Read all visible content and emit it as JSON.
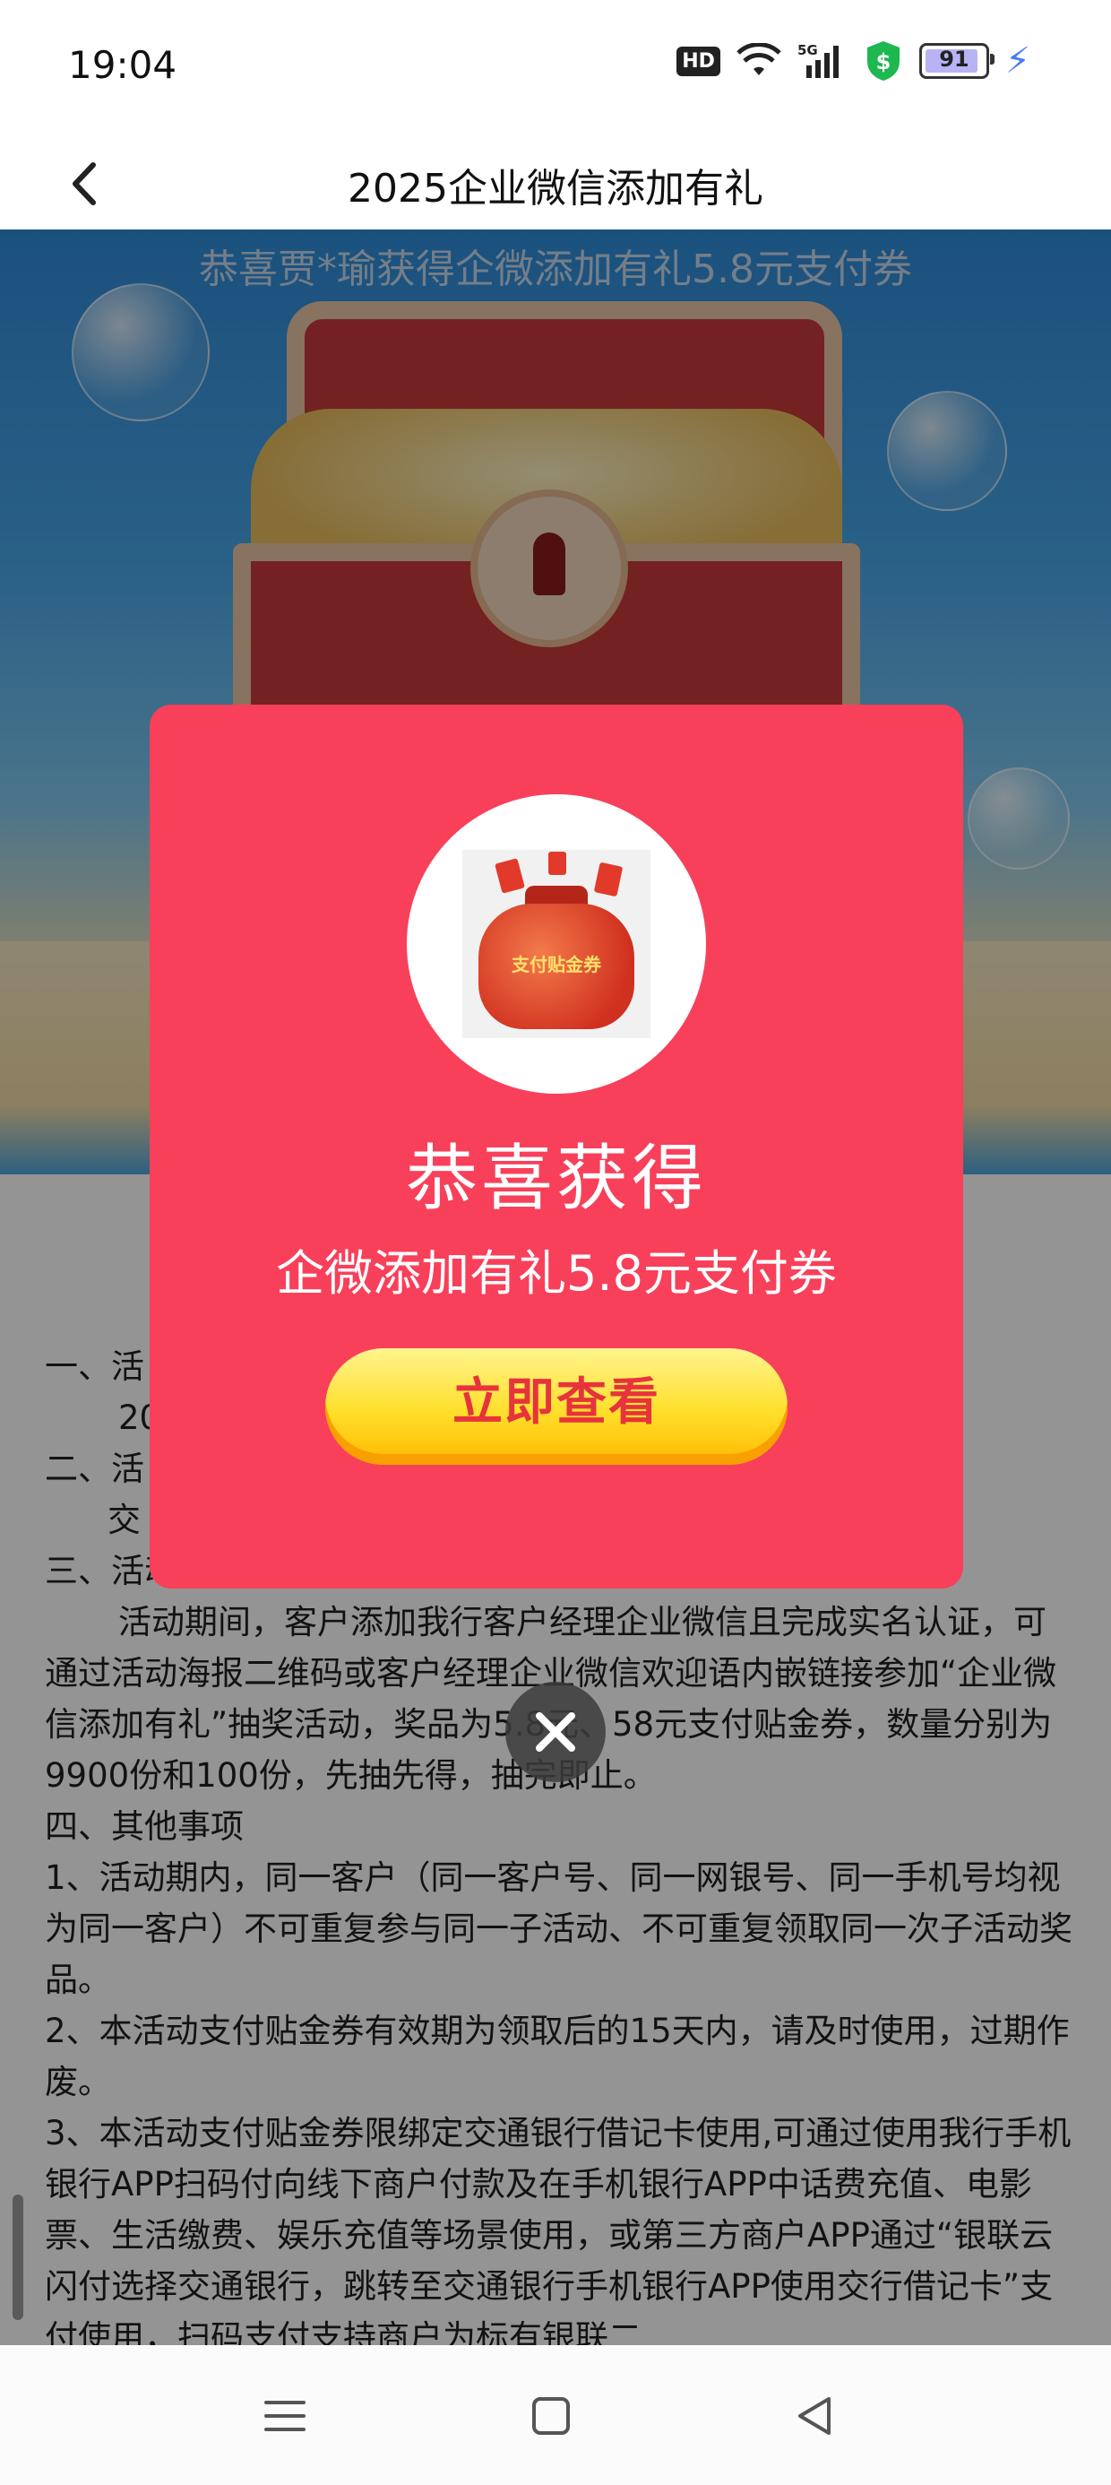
{
  "status_bar": {
    "time": "19:04",
    "hd_label": "HD",
    "network": "5G",
    "battery": "91",
    "battery_level": 0.91
  },
  "nav": {
    "title": "2025企业微信添加有礼"
  },
  "banner": {
    "message": "恭喜贾*瑜获得企微添加有礼5.8元支付券"
  },
  "rules": {
    "section1_prefix": "一、活",
    "section1_line2": "20",
    "section2_prefix": "二、活",
    "section2_line2": "交",
    "section3_title": "三、活动内容",
    "section3_body": "活动期间，客户添加我行客户经理企业微信且完成实名认证，可通过活动海报二维码或客户经理企业微信欢迎语内嵌链接参加“企业微信添加有礼”抽奖活动，奖品为5.8元、58元支付贴金券，数量分别为9900份和100份，先抽先得，抽完即止。",
    "section4_title": "四、其他事项",
    "item1": "1、活动期内，同一客户（同一客户号、同一网银号、同一手机号均视为同一客户）不可重复参与同一子活动、不可重复领取同一次子活动奖品。",
    "item2": "2、本活动支付贴金券有效期为领取后的15天内，请及时使用，过期作废。",
    "item3": "3、本活动支付贴金券限绑定交通银行借记卡使用,可通过使用我行手机银行APP扫码付向线下商户付款及在手机银行APP中话费充值、电影票、生活缴费、娱乐充值等场景使用，或第三方商户APP通过“银联云闪付选择交通银行，跳转至交通银行手机银行APP使用交行借记卡”支付使用，扫码支付支持商户为标有银联二"
  },
  "modal": {
    "prize_image_label": "支付贴金券",
    "title": "恭喜获得",
    "subtitle": "企微添加有礼5.8元支付券",
    "button_label": "立即查看"
  },
  "icons": {
    "back": "chevron-left-icon",
    "close": "close-icon",
    "menu": "menu-icon",
    "home": "home-icon",
    "back_nav": "triangle-back-icon"
  },
  "colors": {
    "modal_bg": "#f8405a",
    "button_yellow": "#ffdf2a",
    "button_text": "#e7333c"
  }
}
